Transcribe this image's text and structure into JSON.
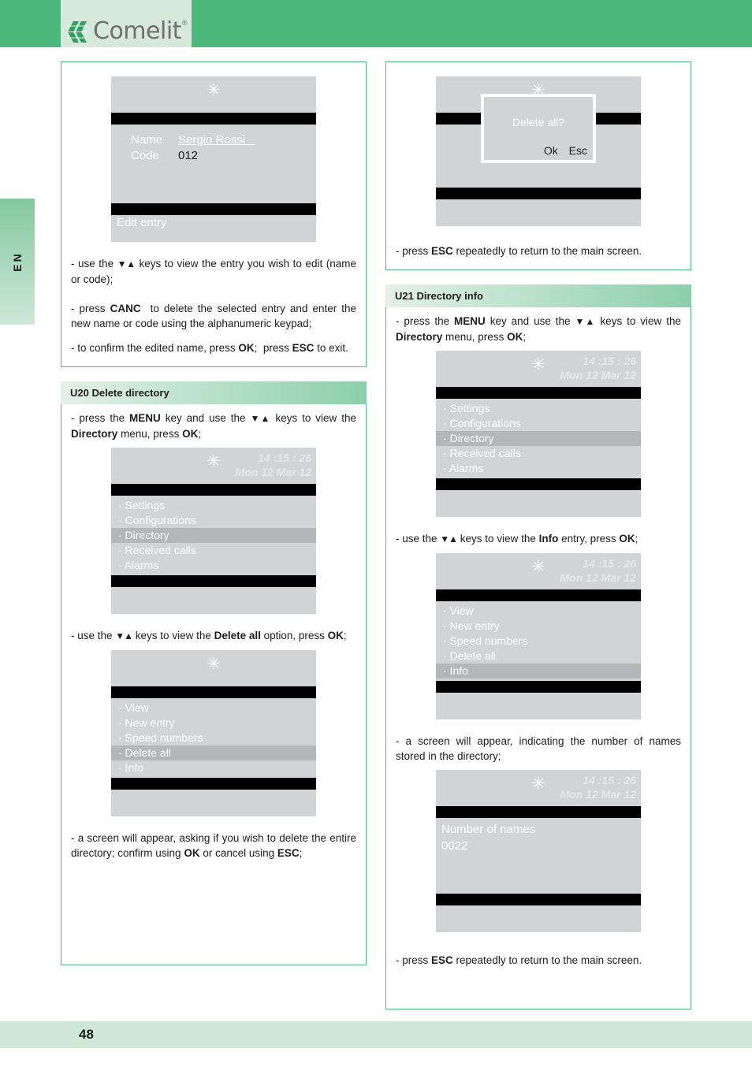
{
  "brand": {
    "name": "Comelit",
    "registered": "®"
  },
  "language_tab": {
    "label": "EN"
  },
  "footer": {
    "page_number": "48"
  },
  "colors": {
    "brand_green": "#4cb87c",
    "header_band": "#4cb87c",
    "logo_plate": "#d6e9da",
    "lcd_background": "#d2d3d5",
    "lcd_selected": "#b5b6b8",
    "lcd_bar": "#000000",
    "footer": "#cfe8d8"
  },
  "icons": {
    "star": "✳",
    "arrow_down": "▼",
    "arrow_up": "▲"
  },
  "left_column": {
    "edit_entry_panel": {
      "screen": {
        "status_star": "✳",
        "fields": [
          {
            "label": "Name",
            "value": "Sergio Rossi",
            "underlined": true
          },
          {
            "label": "Code",
            "value": "012",
            "underlined": false
          }
        ],
        "footer_label": "Edit entry"
      },
      "instructions": [
        {
          "id": "view-entry",
          "prefix": "- use the ",
          "arrows": true,
          "text": " keys to view the entry you wish to edit (name or code);"
        },
        {
          "id": "canc-delete",
          "prefix": "- press ",
          "bold": "CANC",
          "text": "  to delete the selected entry and enter the new name or code using the alphanumeric keypad;"
        },
        {
          "id": "confirm-exit",
          "text_full": "- to confirm the edited name, press OK;  press ESC to exit."
        }
      ]
    },
    "u20": {
      "heading": "U20 Delete directory",
      "step1": {
        "prefix": "- press the ",
        "bold1": "MENU",
        "mid": " key and use the ",
        "arrows": true,
        "mid2": " keys to view the ",
        "bold2": "Directory",
        "suffix": " menu, press ",
        "bold3": "OK",
        "end": ";"
      },
      "screen1": {
        "status_star": "✳",
        "time": "14 :15 : 26",
        "date": "Mon 12 Mar 12",
        "menu": [
          {
            "label": "· Settings",
            "selected": false
          },
          {
            "label": "· Configurations",
            "selected": false
          },
          {
            "label": "· Directory",
            "selected": true
          },
          {
            "label": "· Received calls",
            "selected": false
          },
          {
            "label": "· Alarms",
            "selected": false
          }
        ]
      },
      "step2": {
        "prefix": "- use the ",
        "arrows": true,
        "mid": " keys to view the ",
        "bold1": "Delete all",
        "suffix": " option, press ",
        "bold2": "OK",
        "end": ";"
      },
      "screen2": {
        "status_star": "✳",
        "menu": [
          {
            "label": "· View",
            "selected": false
          },
          {
            "label": "· New entry",
            "selected": false
          },
          {
            "label": "· Speed numbers",
            "selected": false
          },
          {
            "label": "· Delete all",
            "selected": true
          },
          {
            "label": "· Info",
            "selected": false
          }
        ]
      },
      "step3": "- a screen will appear, asking if you wish to delete the entire directory; confirm using OK or cancel using ESC;"
    }
  },
  "right_column": {
    "confirm_panel": {
      "screen": {
        "status_star": "✳",
        "dialog": {
          "question": "Delete all?",
          "buttons": [
            "Ok",
            "Esc"
          ]
        }
      },
      "instruction": {
        "prefix": "- press ",
        "bold": "ESC",
        "suffix": " repeatedly to return to the main screen."
      }
    },
    "u21": {
      "heading": "U21 Directory info",
      "step1": {
        "prefix": "- press the ",
        "bold1": "MENU",
        "mid": " key and use the ",
        "arrows": true,
        "mid2": " keys to view the ",
        "bold2": "Directory",
        "suffix": " menu, press ",
        "bold3": "OK",
        "end": ";"
      },
      "screen1": {
        "status_star": "✳",
        "time": "14 :15 : 26",
        "date": "Mon 12 Mar 12",
        "menu": [
          {
            "label": "· Settings",
            "selected": false
          },
          {
            "label": "· Configurations",
            "selected": false
          },
          {
            "label": "· Directory",
            "selected": true
          },
          {
            "label": "· Received calls",
            "selected": false
          },
          {
            "label": "· Alarms",
            "selected": false
          }
        ]
      },
      "step2": {
        "prefix": "- use the ",
        "arrows": true,
        "mid": " keys to view the ",
        "bold1": "Info",
        "suffix": " entry, press ",
        "bold2": "OK",
        "end": ";"
      },
      "screen2": {
        "status_star": "✳",
        "time": "14 :15 : 26",
        "date": "Mon 12 Mar 12",
        "menu": [
          {
            "label": "· View",
            "selected": false
          },
          {
            "label": "· New entry",
            "selected": false
          },
          {
            "label": "· Speed numbers",
            "selected": false
          },
          {
            "label": "· Delete all",
            "selected": false
          },
          {
            "label": "· Info",
            "selected": true
          }
        ]
      },
      "step3": "- a screen will appear, indicating the number of names stored in the directory;",
      "screen3": {
        "status_star": "✳",
        "time": "14 :15 : 26",
        "date": "Mon 12 Mar 12",
        "lines": [
          "Number of names",
          "0022"
        ]
      },
      "step4": {
        "prefix": "- press ",
        "bold": "ESC",
        "suffix": " repeatedly to return to the main screen."
      }
    }
  }
}
